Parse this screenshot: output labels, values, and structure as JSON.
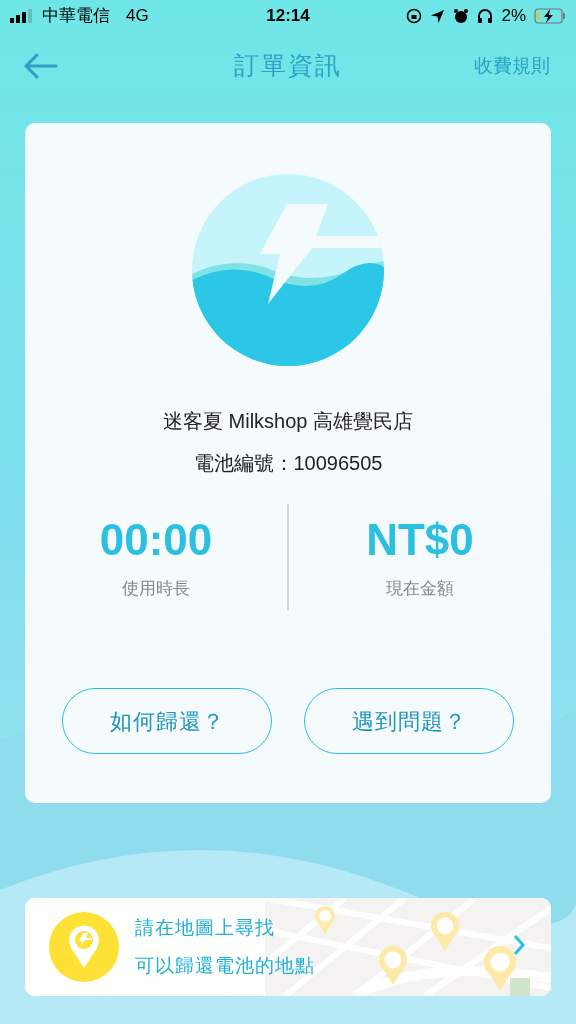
{
  "status_bar": {
    "carrier": "中華電信",
    "network": "4G",
    "time": "12:14",
    "battery": "2%"
  },
  "nav": {
    "title": "訂單資訊",
    "action": "收費規則"
  },
  "order": {
    "store": "迷客夏 Milkshop 高雄覺民店",
    "battery_id": "電池編號：10096505",
    "stats": [
      {
        "value": "00:00",
        "label": "使用時長"
      },
      {
        "value": "NT$0",
        "label": "現在金額"
      }
    ],
    "buttons": [
      "如何歸還？",
      "遇到問題？"
    ]
  },
  "map_banner": {
    "lines": [
      "請在地圖上尋找",
      "可以歸還電池的地點"
    ]
  }
}
